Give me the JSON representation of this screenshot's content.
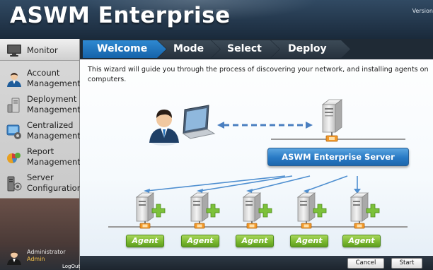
{
  "header": {
    "title": "ASWM Enterprise",
    "version_label": "Version"
  },
  "sidebar": {
    "items": [
      {
        "id": "monitor",
        "label": "Monitor",
        "icon": "monitor-icon"
      },
      {
        "id": "account",
        "label_line1": "Account",
        "label_line2": "Management",
        "icon": "user-icon"
      },
      {
        "id": "deployment",
        "label_line1": "Deployment",
        "label_line2": "Management",
        "icon": "deployment-icon"
      },
      {
        "id": "centralized",
        "label_line1": "Centralized",
        "label_line2": "Management",
        "icon": "centralized-icon"
      },
      {
        "id": "report",
        "label_line1": "Report",
        "label_line2": "Management",
        "icon": "report-icon"
      },
      {
        "id": "server",
        "label_line1": "Server",
        "label_line2": "Configuration",
        "icon": "server-config-icon"
      }
    ],
    "user": {
      "name": "Administrator",
      "role": "Admin",
      "logout": "LogOut"
    }
  },
  "wizard": {
    "steps": [
      "Welcome",
      "Mode",
      "Select",
      "Deploy"
    ],
    "active_step": "Welcome",
    "intro": "This wizard will guide you through the process of discovering your network, and installing agents on computers.",
    "server_label": "ASWM  Enterprise Server",
    "agent_labels": [
      "Agent",
      "Agent",
      "Agent",
      "Agent",
      "Agent"
    ]
  },
  "footer": {
    "cancel_label": "Cancel",
    "start_label": "Start"
  },
  "colors": {
    "header_bg": "#24384d",
    "step_active": "#1f77c4",
    "step_inactive": "#2f3b47",
    "server_button": "#2879c4",
    "agent_tag": "#78b62d",
    "sidebar_bg": "#cfcfcf"
  }
}
